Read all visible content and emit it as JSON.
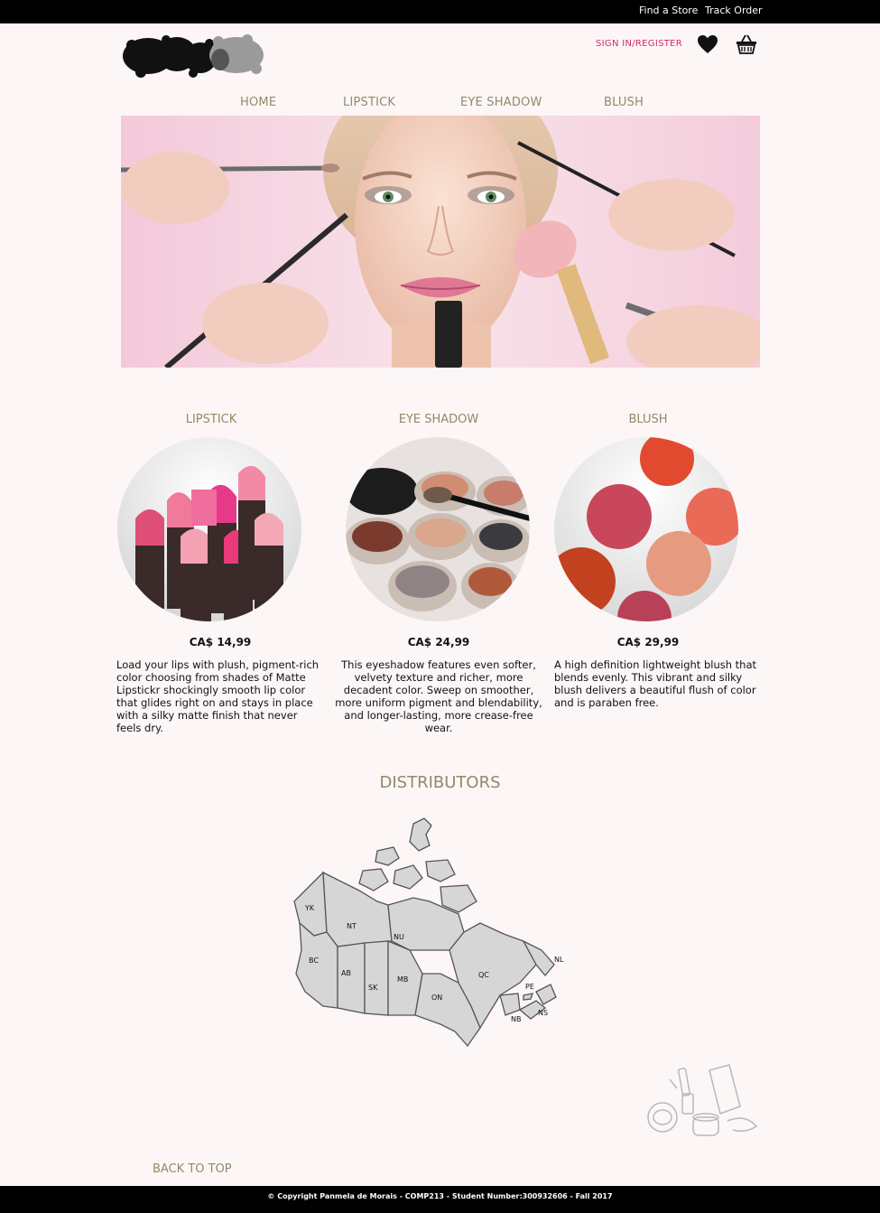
{
  "topbar": {
    "find_store": "Find a Store",
    "track_order": "Track Order"
  },
  "header": {
    "signin": "SIGN IN/REGISTER",
    "wishlist_icon": "heart-icon",
    "cart_icon": "basket-icon"
  },
  "nav": {
    "home": "HOME",
    "lipstick": "LIPSTICK",
    "eyeshadow": "EYE SHADOW",
    "blush": "BLUSH"
  },
  "products": [
    {
      "title": "LIPSTICK",
      "price": "CA$ 14,99",
      "description": "Load your lips with plush, pigment-rich color choosing from shades of Matte Lipstickr shockingly smooth lip color that glides right on and stays in place with a silky matte finish that never feels dry."
    },
    {
      "title": "EYE SHADOW",
      "price": "CA$ 24,99",
      "description": "This eyeshadow features even softer, velvety texture and richer, more decadent color. Sweep on smoother, more uniform pigment and blendability, and longer-lasting, more crease-free wear."
    },
    {
      "title": "BLUSH",
      "price": "CA$ 29,99",
      "description": "A high definition lightweight blush that blends evenly. This vibrant and silky blush delivers a beautiful flush of color and is paraben free."
    }
  ],
  "distributors": {
    "title": "DISTRIBUTORS",
    "provinces": [
      "YK",
      "NT",
      "NU",
      "BC",
      "AB",
      "SK",
      "MB",
      "ON",
      "QC",
      "NL",
      "PE",
      "NS",
      "NB"
    ]
  },
  "back_to_top": "BACK TO TOP",
  "footer": "© Copyright Panmela de Morais - COMP213 - Student Number:300932606 - Fall 2017",
  "colors": {
    "accent": "#8e8b6a",
    "signin": "#d2286a",
    "background": "#fdf6f6"
  }
}
